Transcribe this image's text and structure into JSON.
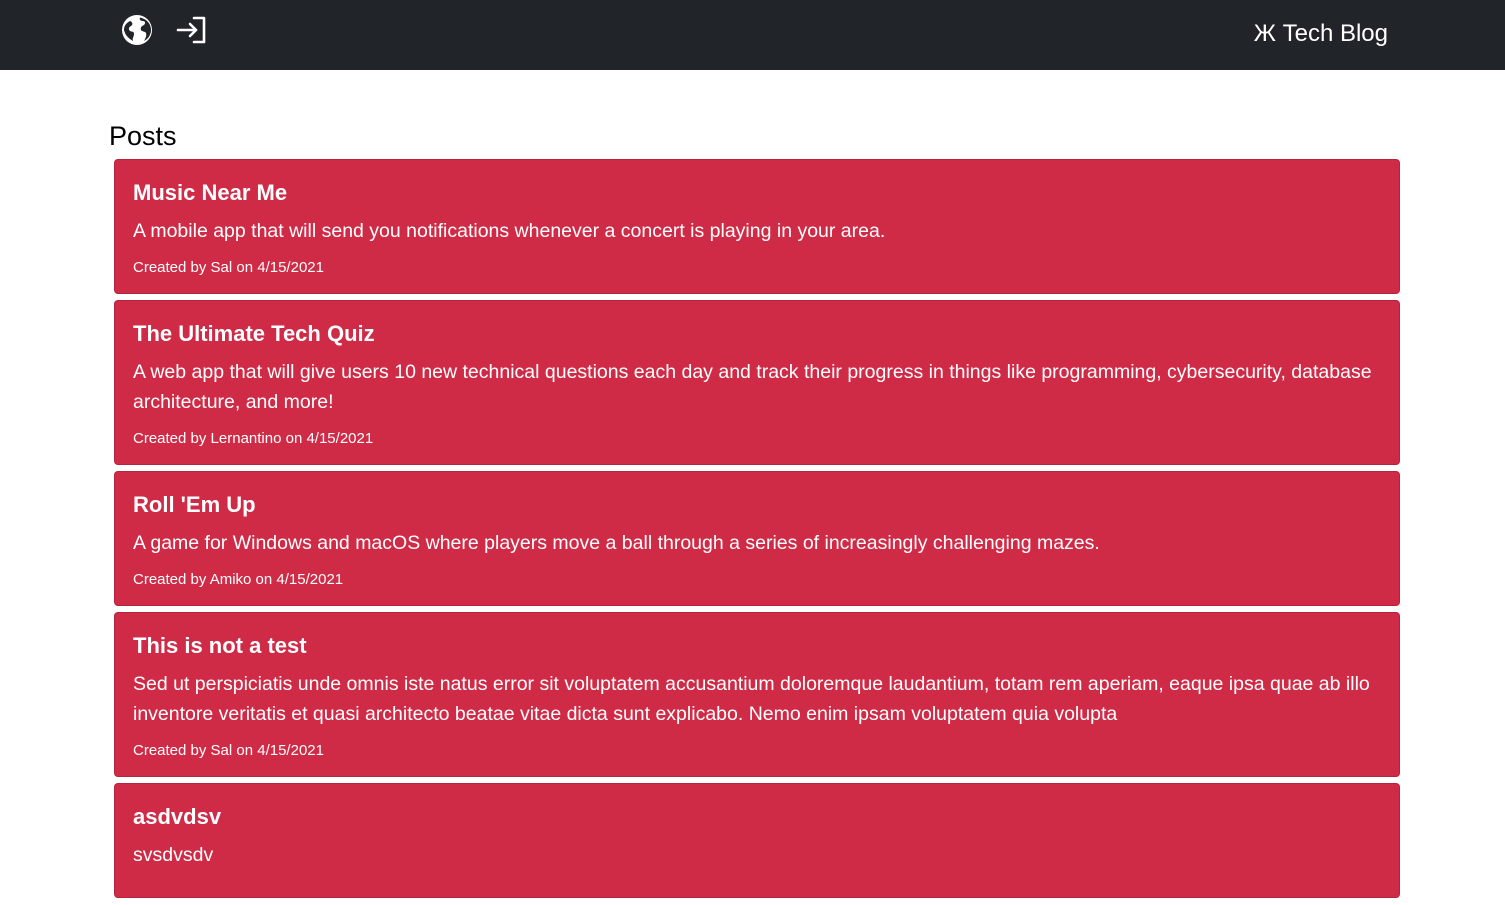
{
  "header": {
    "brand": "Ж Tech Blog",
    "icons": [
      "globe-icon",
      "login-icon"
    ]
  },
  "main": {
    "title": "Posts",
    "posts": [
      {
        "title": "Music Near Me",
        "body": "A mobile app that will send you notifications whenever a concert is playing in your area.",
        "meta": "Created by Sal on 4/15/2021"
      },
      {
        "title": "The Ultimate Tech Quiz",
        "body": "A web app that will give users 10 new technical questions each day and track their progress in things like programming, cybersecurity, database architecture, and more!",
        "meta": "Created by Lernantino on 4/15/2021"
      },
      {
        "title": "Roll 'Em Up",
        "body": "A game for Windows and macOS where players move a ball through a series of increasingly challenging mazes.",
        "meta": "Created by Amiko on 4/15/2021"
      },
      {
        "title": "This is not a test",
        "body": "Sed ut perspiciatis unde omnis iste natus error sit voluptatem accusantium doloremque laudantium, totam rem aperiam, eaque ipsa quae ab illo inventore veritatis et quasi architecto beatae vitae dicta sunt explicabo. Nemo enim ipsam voluptatem quia volupta",
        "meta": "Created by Sal on 4/15/2021"
      },
      {
        "title": "asdvdsv",
        "body": "svsdvsdv",
        "meta": ""
      }
    ]
  },
  "colors": {
    "navbar": "#212529",
    "card": "#d02b46",
    "text_on_card": "#ffffff"
  }
}
